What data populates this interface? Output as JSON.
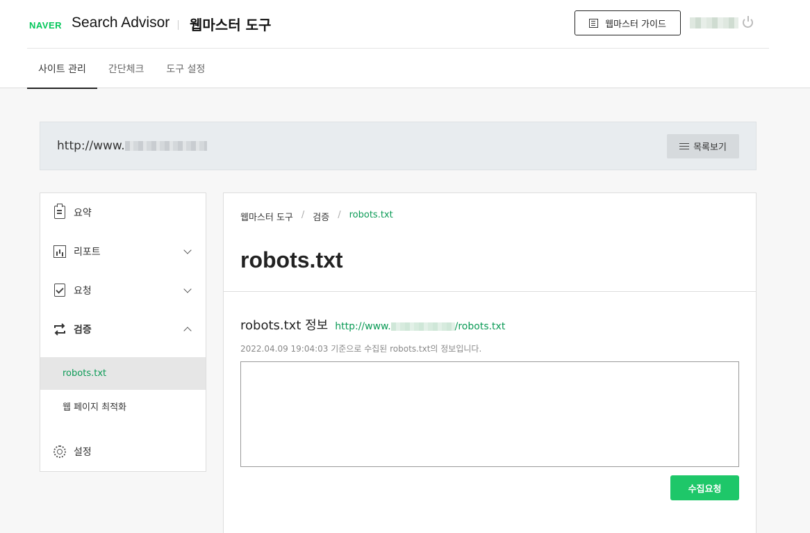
{
  "header": {
    "naver_logo": "NAVER",
    "brand": "Search Advisor",
    "tool_title": "웹마스터 도구",
    "guide_button": "웹마스터 가이드"
  },
  "nav": {
    "tabs": [
      {
        "label": "사이트 관리",
        "active": true
      },
      {
        "label": "간단체크",
        "active": false
      },
      {
        "label": "도구 설정",
        "active": false
      }
    ]
  },
  "site_bar": {
    "url_prefix": "http://www.",
    "list_button": "목록보기"
  },
  "sidebar": {
    "items": [
      {
        "label": "요약",
        "icon": "clipboard-icon"
      },
      {
        "label": "리포트",
        "icon": "chart-icon"
      },
      {
        "label": "요청",
        "icon": "checklist-icon"
      },
      {
        "label": "검증",
        "icon": "swap-icon"
      },
      {
        "label": "설정",
        "icon": "gear-icon"
      }
    ],
    "sub_items": [
      {
        "label": "robots.txt",
        "active": true
      },
      {
        "label": "웹 페이지 최적화",
        "active": false
      }
    ]
  },
  "content": {
    "breadcrumb": [
      "웹마스터 도구",
      "검증",
      "robots.txt"
    ],
    "page_title": "robots.txt",
    "section_title": "robots.txt 정보",
    "robots_url_prefix": "http://www.",
    "robots_url_suffix": "/robots.txt",
    "collected_note": "2022.04.09 19:04:03 기준으로 수집된 robots.txt의 정보입니다.",
    "robots_content": "",
    "collect_button": "수집요청"
  },
  "colors": {
    "naver_green": "#03c75a",
    "link_green": "#0a9a55",
    "button_green": "#1ec769"
  }
}
